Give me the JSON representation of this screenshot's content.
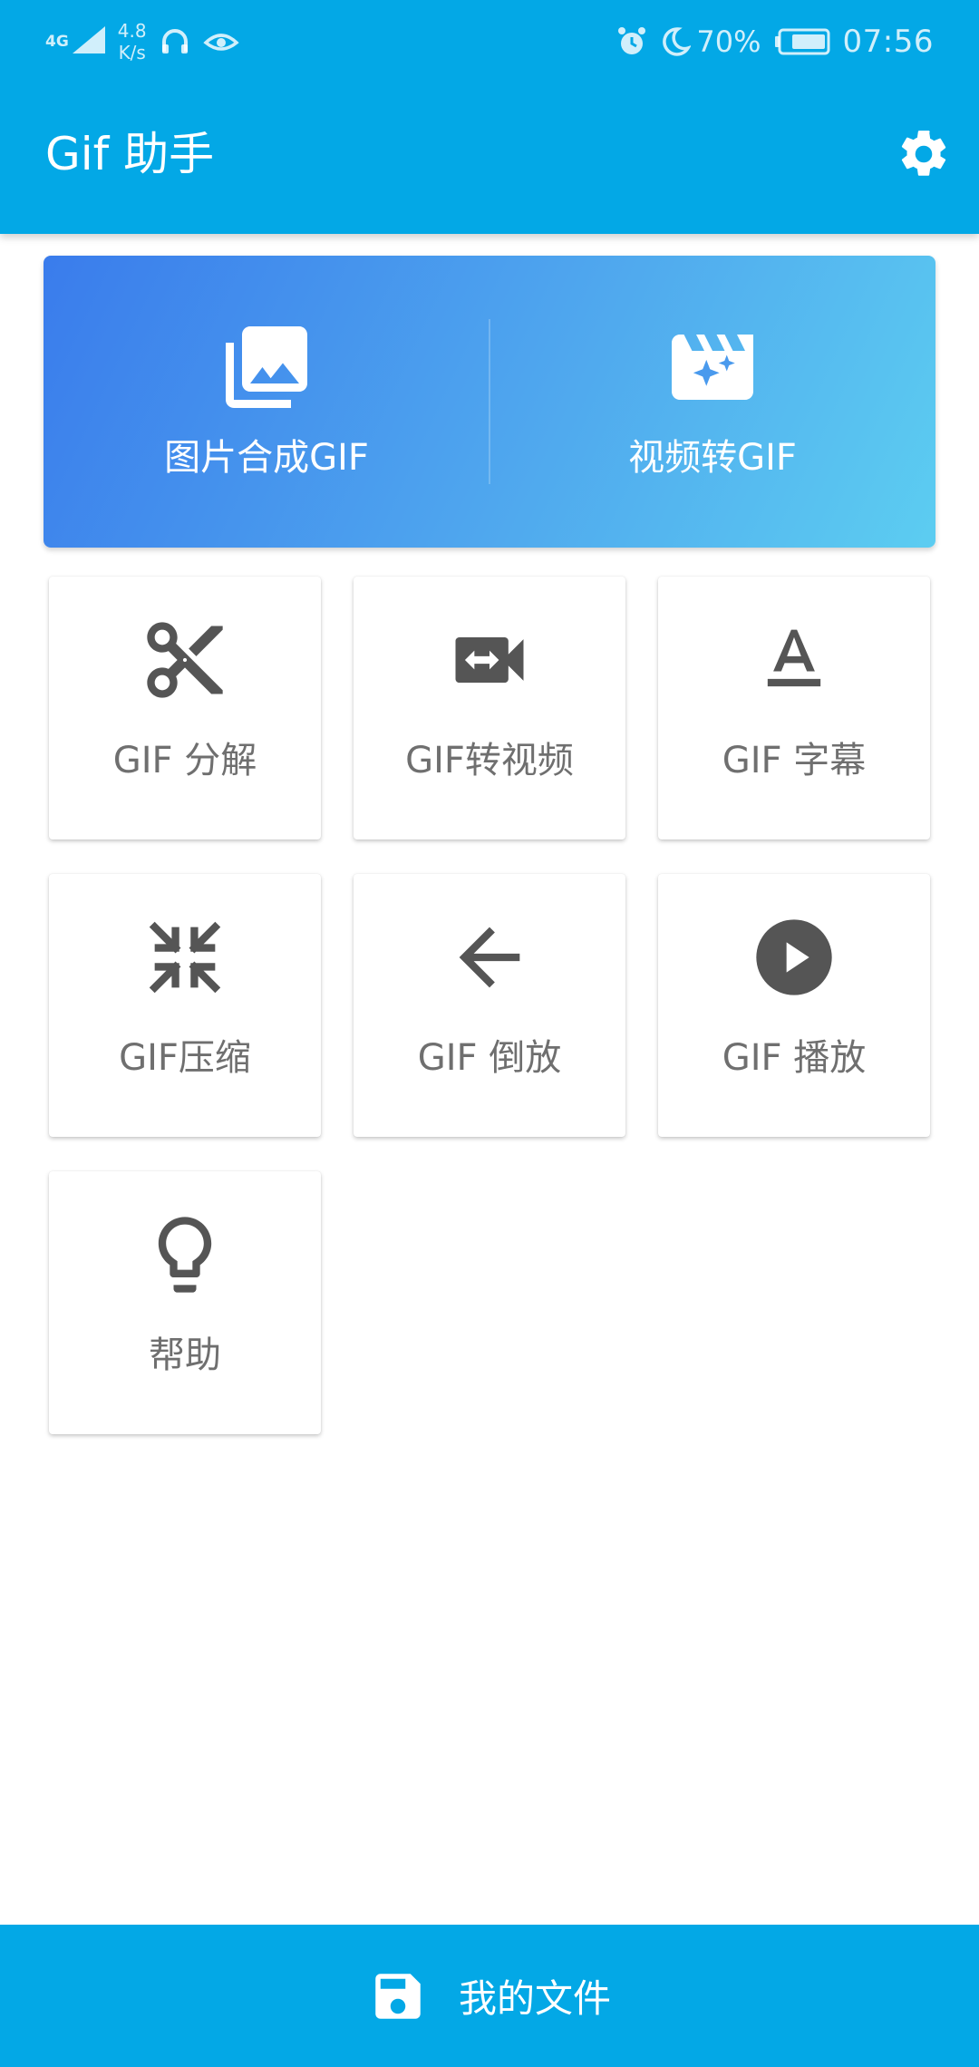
{
  "status_bar": {
    "network_type": "4G",
    "speed_value": "4.8",
    "speed_unit": "K/s",
    "battery_percent": "70%",
    "time": "07:56"
  },
  "app_bar": {
    "title": "Gif 助手"
  },
  "banner": {
    "items": [
      {
        "label": "图片合成GIF",
        "icon": "photo-library-icon"
      },
      {
        "label": "视频转GIF",
        "icon": "movie-sparkle-icon"
      }
    ]
  },
  "tools": [
    {
      "label": "GIF 分解",
      "icon": "scissors-icon"
    },
    {
      "label": "GIF转视频",
      "icon": "video-convert-icon"
    },
    {
      "label": "GIF 字幕",
      "icon": "text-format-icon"
    },
    {
      "label": "GIF压缩",
      "icon": "compress-arrows-icon"
    },
    {
      "label": "GIF 倒放",
      "icon": "arrow-back-icon"
    },
    {
      "label": "GIF 播放",
      "icon": "play-circle-icon"
    },
    {
      "label": "帮助",
      "icon": "lightbulb-icon"
    }
  ],
  "bottom_bar": {
    "label": "我的文件",
    "icon": "save-icon"
  },
  "colors": {
    "primary": "#03a8e6",
    "banner_gradient_start": "#3a7cec",
    "banner_gradient_end": "#5ccdf1",
    "tile_icon": "#555555",
    "tile_text": "#6f6f6f"
  }
}
